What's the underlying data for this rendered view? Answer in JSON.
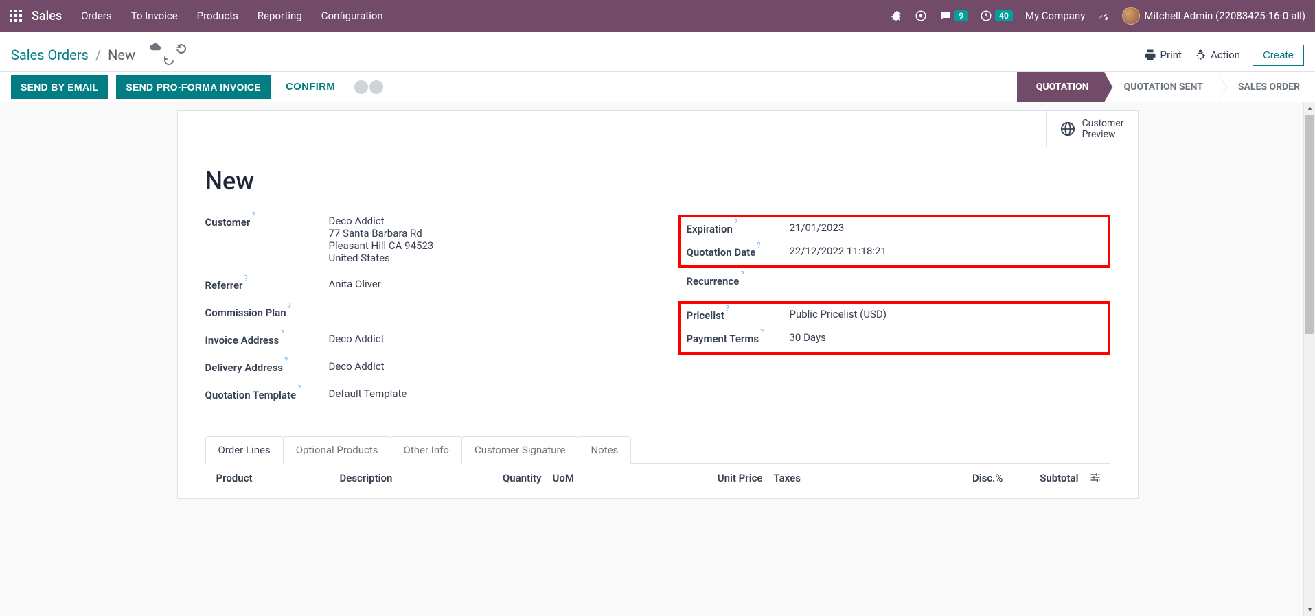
{
  "navbar": {
    "brand": "Sales",
    "menu": [
      "Orders",
      "To Invoice",
      "Products",
      "Reporting",
      "Configuration"
    ],
    "messages_count": "9",
    "activities_count": "40",
    "company": "My Company",
    "user": "Mitchell Admin (22083425-16-0-all)"
  },
  "breadcrumb": {
    "parent": "Sales Orders",
    "current": "New"
  },
  "cp_buttons": {
    "print": "Print",
    "action": "Action",
    "create": "Create"
  },
  "statusbar": {
    "send_email": "SEND BY EMAIL",
    "send_proforma": "SEND PRO-FORMA INVOICE",
    "confirm": "CONFIRM",
    "steps": [
      "QUOTATION",
      "QUOTATION SENT",
      "SALES ORDER"
    ]
  },
  "button_box": {
    "customer_preview_l1": "Customer",
    "customer_preview_l2": "Preview"
  },
  "form": {
    "title": "New",
    "left": {
      "customer_label": "Customer",
      "customer_name": "Deco Addict",
      "customer_addr1": "77 Santa Barbara Rd",
      "customer_addr2": "Pleasant Hill CA 94523",
      "customer_addr3": "United States",
      "referrer_label": "Referrer",
      "referrer_value": "Anita Oliver",
      "commission_label": "Commission Plan",
      "invoice_addr_label": "Invoice Address",
      "invoice_addr_value": "Deco Addict",
      "delivery_addr_label": "Delivery Address",
      "delivery_addr_value": "Deco Addict",
      "quote_tmpl_label": "Quotation Template",
      "quote_tmpl_value": "Default Template"
    },
    "right": {
      "expiration_label": "Expiration",
      "expiration_value": "21/01/2023",
      "quotation_date_label": "Quotation Date",
      "quotation_date_value": "22/12/2022 11:18:21",
      "recurrence_label": "Recurrence",
      "pricelist_label": "Pricelist",
      "pricelist_value": "Public Pricelist (USD)",
      "payment_terms_label": "Payment Terms",
      "payment_terms_value": "30 Days"
    }
  },
  "tabs": [
    "Order Lines",
    "Optional Products",
    "Other Info",
    "Customer Signature",
    "Notes"
  ],
  "table_headers": {
    "product": "Product",
    "description": "Description",
    "quantity": "Quantity",
    "uom": "UoM",
    "unit_price": "Unit Price",
    "taxes": "Taxes",
    "disc": "Disc.%",
    "subtotal": "Subtotal"
  }
}
